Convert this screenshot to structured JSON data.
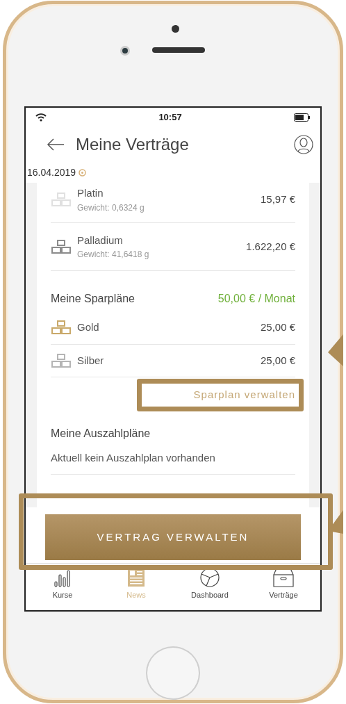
{
  "status_bar": {
    "time": "10:57"
  },
  "header": {
    "title": "Meine Verträge"
  },
  "date": "16.04.2019",
  "holdings": [
    {
      "name": "Platin",
      "weight": "Gewicht: 0,6324 g",
      "value": "15,97 €",
      "color": "#e0e0e0"
    },
    {
      "name": "Palladium",
      "weight": "Gewicht: 41,6418 g",
      "value": "1.622,20 €",
      "color": "#8c8c8c"
    }
  ],
  "savings": {
    "title": "Meine Sparpläne",
    "total": "50,00 € / Monat",
    "items": [
      {
        "name": "Gold",
        "value": "25,00 €",
        "color": "#c9a96a"
      },
      {
        "name": "Silber",
        "value": "25,00 €",
        "color": "#b5b5b5"
      }
    ],
    "manage_link": "Sparplan verwalten",
    "highlighted": true
  },
  "payouts": {
    "title": "Meine Auszahlpläne",
    "empty_text": "Aktuell kein Auszahlplan vorhanden"
  },
  "primary_button": {
    "label": "VERTRAG VERWALTEN",
    "highlighted": true
  },
  "tab_bar": [
    {
      "label": "Kurse",
      "selected": false
    },
    {
      "label": "News",
      "selected": true
    },
    {
      "label": "Dashboard",
      "selected": false
    },
    {
      "label": "Verträge",
      "selected": false
    }
  ]
}
